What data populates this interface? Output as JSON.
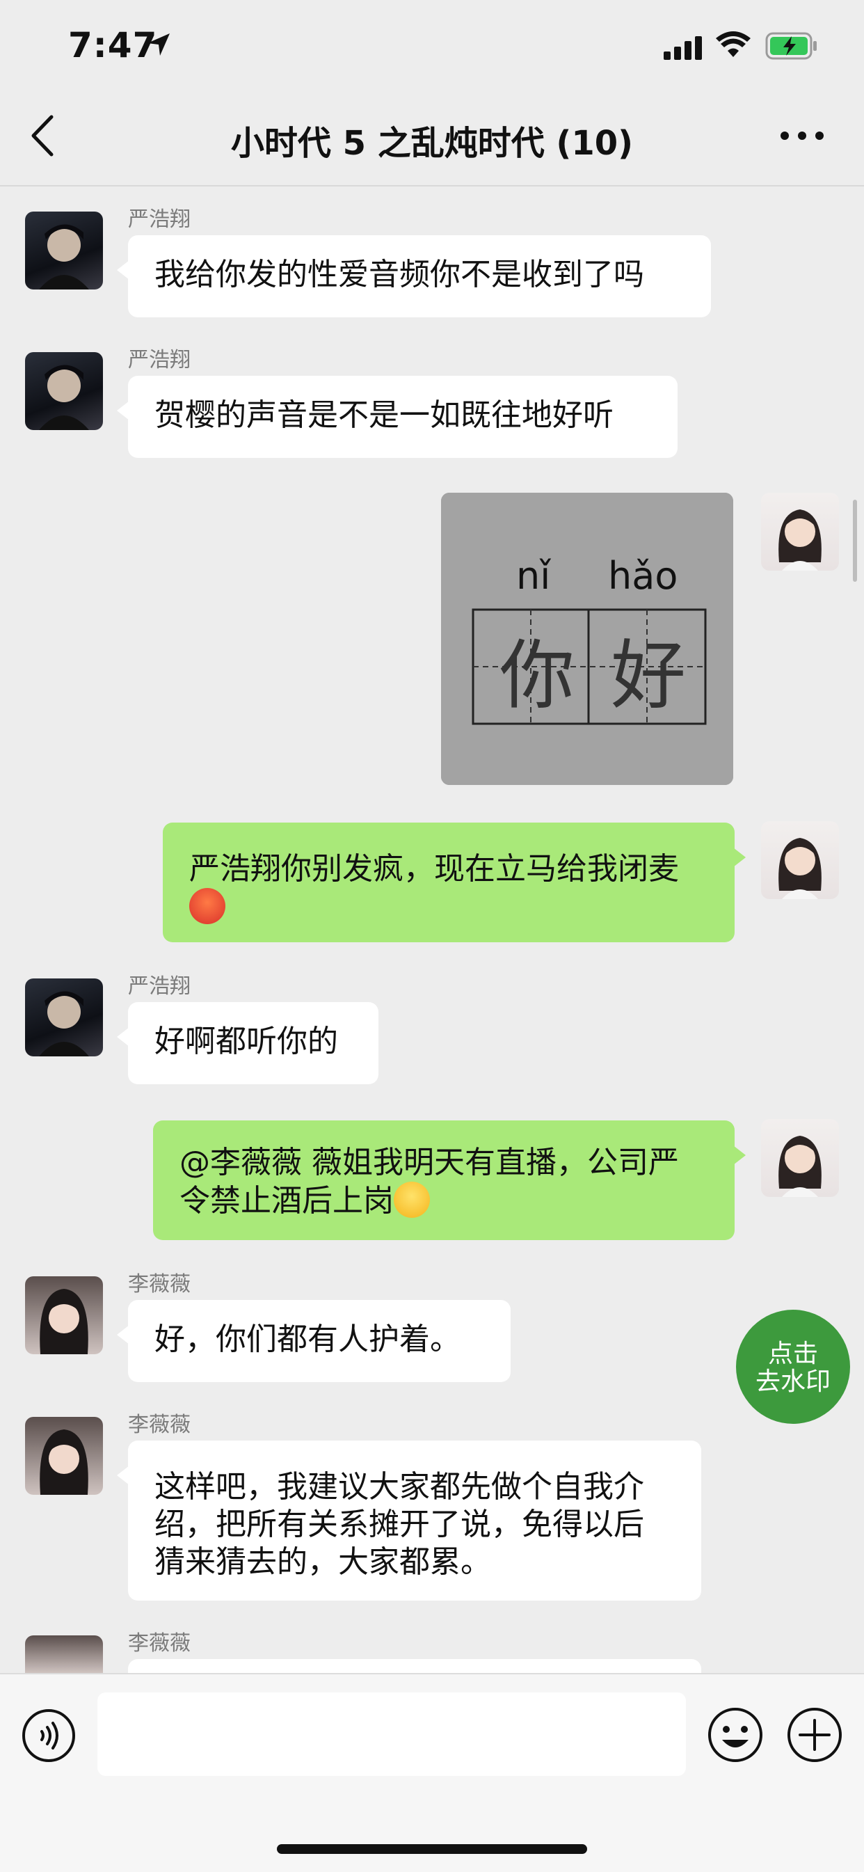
{
  "status_bar": {
    "time": "7:47"
  },
  "header": {
    "title": "小时代 5 之乱炖时代 (10)"
  },
  "messages": [
    {
      "sender": "严浩翔",
      "text": "我给你发的性爱音频你不是收到了吗"
    },
    {
      "sender": "严浩翔",
      "text": "贺樱的声音是不是一如既往地好听"
    },
    {
      "image": {
        "pinyin_1": "nǐ",
        "pinyin_2": "hǎo",
        "char_1": "你",
        "char_2": "好"
      }
    },
    {
      "text": "严浩翔你别发疯，现在立马给我闭麦"
    },
    {
      "sender": "严浩翔",
      "text": "好啊都听你的"
    },
    {
      "text_line1": "@李薇薇 薇姐我明天有直播，公司严",
      "text_line2": "令禁止酒后上岗"
    },
    {
      "sender": "李薇薇",
      "text": "好，你们都有人护着。"
    },
    {
      "sender": "李薇薇",
      "text_line1": "这样吧，我建议大家都先做个自我介",
      "text_line2": "绍，把所有关系摊开了说，免得以后",
      "text_line3": "猜来猜去的，大家都累。"
    },
    {
      "sender": "李薇薇"
    }
  ],
  "watermark_button": {
    "line1": "点击",
    "line2": "去水印"
  },
  "colors": {
    "green_bubble": "#a9e979",
    "background": "#ededed",
    "watermark_button": "#3d9a3d"
  },
  "icons": [
    "back-icon",
    "more-icon",
    "voice-icon",
    "emoji-icon",
    "plus-icon",
    "location-arrow-icon",
    "signal-icon",
    "wifi-icon",
    "battery-charging-icon"
  ]
}
